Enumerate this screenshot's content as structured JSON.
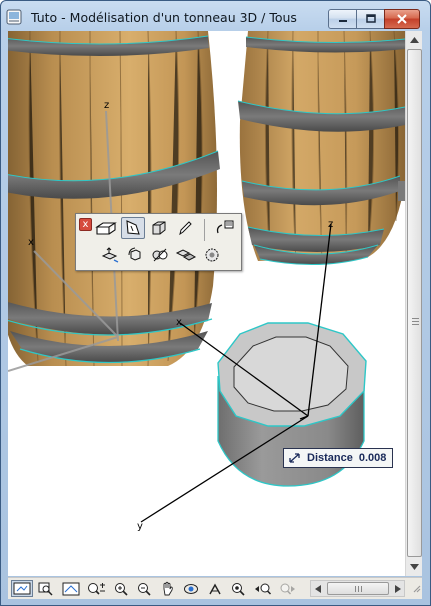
{
  "window": {
    "title": "Tuto - Modélisation d'un tonneau 3D / Tous"
  },
  "viewport": {
    "axis_labels": {
      "z_barrel_left": "z",
      "x_barrel_left": "x",
      "z_gizmo": "z",
      "x_gizmo": "x",
      "y_gizmo": "y"
    },
    "distance_tooltip": {
      "label": "Distance",
      "value": "0.008"
    }
  },
  "palette": {
    "close_label": "x",
    "row1": [
      "box-icon",
      "pointer-face-icon",
      "cube-face-icon",
      "pencil-icon",
      "link-icon"
    ],
    "row2": [
      "push-pull-icon",
      "rotate-cube-icon",
      "split-icon",
      "boolean-icon",
      "sphere-icon"
    ]
  },
  "bottom_toolbar": {
    "buttons": [
      "fit-window-icon",
      "zoom-area-icon",
      "perspective-icon",
      "zoom-plus-minus-icon",
      "zoom-in-icon",
      "zoom-out-icon",
      "pan-hand-icon",
      "orbit-icon",
      "walk-icon",
      "look-around-icon",
      "previous-view-icon",
      "next-view-icon"
    ]
  },
  "colors": {
    "selection_edge": "#2ec7c7",
    "barrel_wood": "#c9a05e",
    "barrel_hoop": "#6a6a6a",
    "window_frame": "#b7cfe9"
  }
}
